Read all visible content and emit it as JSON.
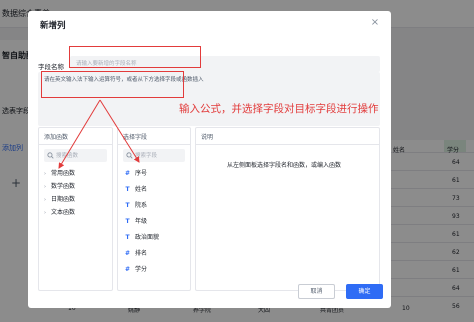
{
  "background": {
    "app_title": "数据综合素养",
    "subheading": "智自助配",
    "side_a": "选表字段",
    "side_b": "添加列",
    "plus": "+",
    "col_name": "姓名",
    "col_score": "学分",
    "numbers": [
      "64",
      "61",
      "73",
      "93",
      "61",
      "62",
      "61",
      "64",
      "56"
    ],
    "bottom_row": [
      "10",
      "姚静",
      "养学院",
      "大四",
      "共青团员",
      "10"
    ]
  },
  "modal": {
    "title": "新增列",
    "close_glyph": "×",
    "name_label": "字段名称",
    "name_placeholder": "请输入要新增的字段名称",
    "formula_placeholder": "请在英文输入法下输入运算符号，或者从下方选择字段或函数插入",
    "functions_panel": {
      "title": "添加函数",
      "search_placeholder": "搜索函数",
      "items": [
        {
          "label": "常用函数"
        },
        {
          "label": "数学函数"
        },
        {
          "label": "日期函数"
        },
        {
          "label": "文本函数"
        }
      ]
    },
    "fields_panel": {
      "title": "选择字段",
      "search_placeholder": "搜索字段",
      "items": [
        {
          "icon": "#",
          "label": "序号"
        },
        {
          "icon": "T",
          "label": "姓名"
        },
        {
          "icon": "T",
          "label": "院系"
        },
        {
          "icon": "T",
          "label": "年级"
        },
        {
          "icon": "T",
          "label": "政治面貌"
        },
        {
          "icon": "#",
          "label": "排名"
        },
        {
          "icon": "#",
          "label": "学分"
        }
      ]
    },
    "description_panel": {
      "title": "说明",
      "text": "从左侧面板选择字段名和函数，或编入函数"
    },
    "cancel_label": "取消",
    "ok_label": "确定"
  },
  "annotation": {
    "text": "输入公式，并选择字段对目标字段进行操作",
    "color": "#e23b3b"
  },
  "colors": {
    "primary": "#2f6cf5",
    "annotation_red": "#e23b3b"
  }
}
